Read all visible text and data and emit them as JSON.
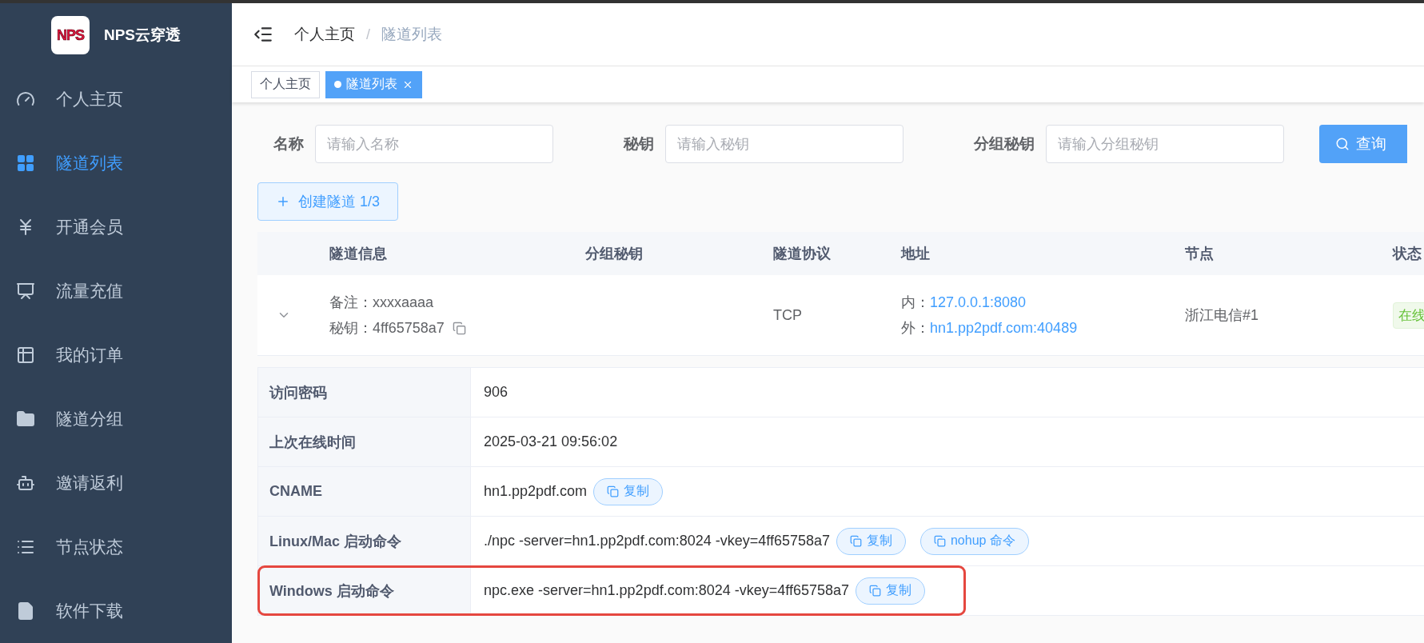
{
  "brand": {
    "logo": "NPS",
    "name": "NPS云穿透"
  },
  "sidebar": {
    "items": [
      {
        "label": "个人主页",
        "selected": false
      },
      {
        "label": "隧道列表",
        "selected": true
      },
      {
        "label": "开通会员",
        "selected": false
      },
      {
        "label": "流量充值",
        "selected": false
      },
      {
        "label": "我的订单",
        "selected": false
      },
      {
        "label": "隧道分组",
        "selected": false
      },
      {
        "label": "邀请返利",
        "selected": false
      },
      {
        "label": "节点状态",
        "selected": false
      },
      {
        "label": "软件下载",
        "selected": false
      }
    ]
  },
  "breadcrumb": [
    "个人主页",
    "隧道列表"
  ],
  "breadcrumb_separator": "/",
  "tabs": [
    {
      "label": "个人主页",
      "selected": false,
      "closable": false
    },
    {
      "label": "隧道列表",
      "selected": true,
      "closable": true
    }
  ],
  "search": {
    "fields": [
      {
        "label": "名称",
        "placeholder": "请输入名称"
      },
      {
        "label": "秘钥",
        "placeholder": "请输入秘钥"
      },
      {
        "label": "分组秘钥",
        "placeholder": "请输入分组秘钥"
      }
    ],
    "button": "查询"
  },
  "create_button": "创建隧道 1/3",
  "table": {
    "columns": [
      "隧道信息",
      "分组秘钥",
      "隧道协议",
      "地址",
      "节点",
      "状态"
    ],
    "rows": [
      {
        "expanded": true,
        "remark_label": "备注：",
        "remark": "xxxxaaaa",
        "key_label": "秘钥：",
        "key": "4ff65758a7",
        "protocol": "TCP",
        "inner_label": "内：",
        "inner": "127.0.0.1:8080",
        "outer_label": "外：",
        "outer": "hn1.pp2pdf.com:40489",
        "node": "浙江电信#1",
        "status": "在线"
      }
    ]
  },
  "details": [
    {
      "label": "访问密码",
      "value": "906",
      "highlighted": false
    },
    {
      "label": "上次在线时间",
      "value": "2025-03-21 09:56:02",
      "highlighted": false
    },
    {
      "label": "CNAME",
      "value": "hn1.pp2pdf.com",
      "buttons": [
        "复制"
      ],
      "highlighted": false
    },
    {
      "label": "Linux/Mac 启动命令",
      "value": "./npc -server=hn1.pp2pdf.com:8024 -vkey=4ff65758a7",
      "buttons": [
        "复制",
        "nohup 命令"
      ],
      "highlighted": false
    },
    {
      "label": "Windows 启动命令",
      "value": "npc.exe -server=hn1.pp2pdf.com:8024 -vkey=4ff65758a7",
      "buttons": [
        "复制"
      ],
      "highlighted": true
    }
  ]
}
